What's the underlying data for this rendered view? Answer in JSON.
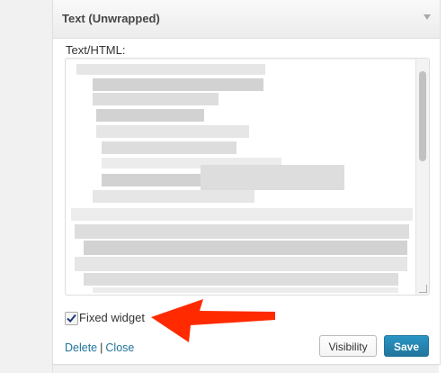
{
  "widget": {
    "title": "Text (Unwrapped)",
    "field_label": "Text/HTML:",
    "checkbox": {
      "label": "Fixed widget",
      "checked": true
    },
    "footer": {
      "delete": "Delete",
      "separator": "|",
      "close": "Close"
    },
    "buttons": {
      "visibility": "Visibility",
      "save": "Save"
    }
  },
  "colors": {
    "accent": "#21759b",
    "annotation_arrow": "#ff2a00"
  },
  "icons": {
    "toggle": "chevron-down-icon",
    "check": "check-icon",
    "annotation": "red-arrow-annotation"
  }
}
